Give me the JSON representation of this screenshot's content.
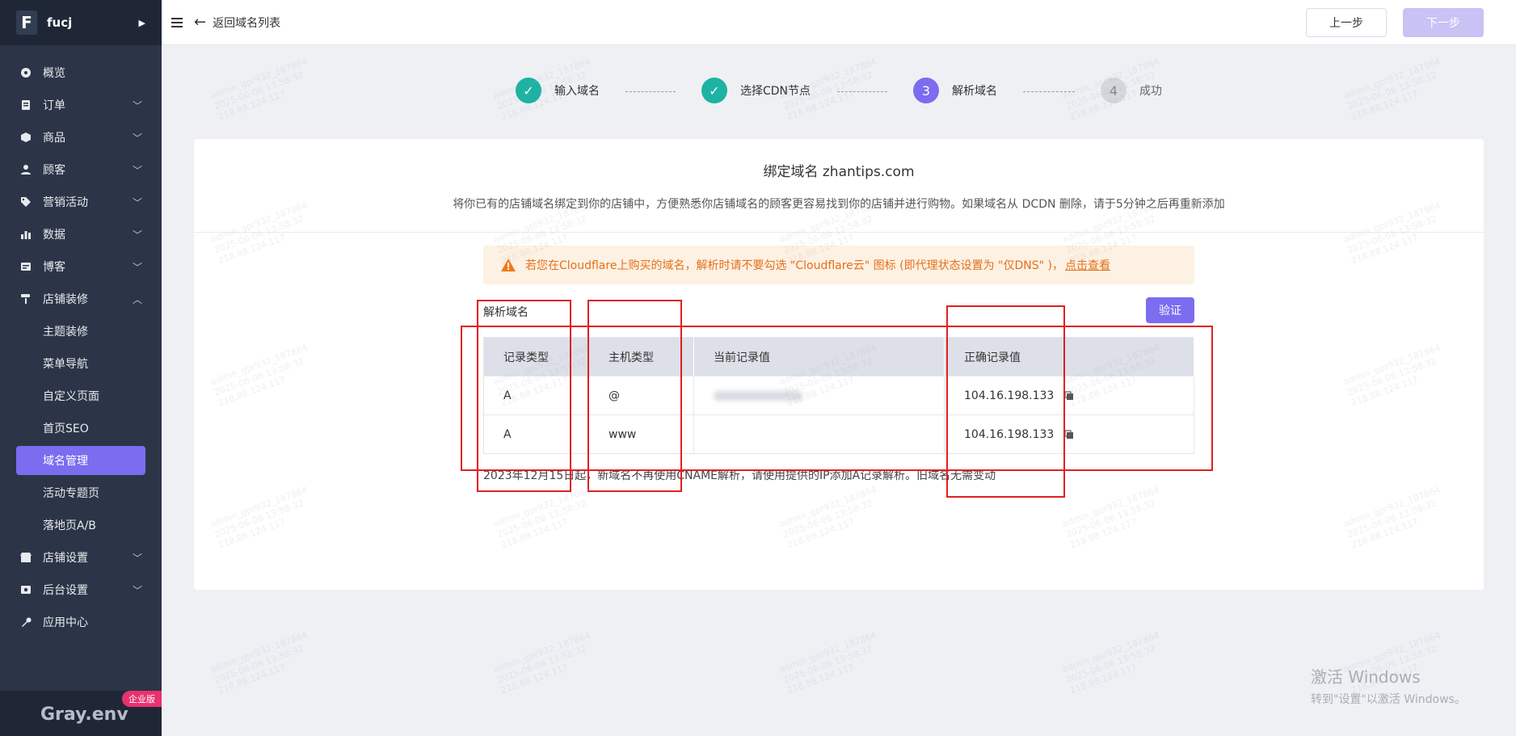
{
  "sidebar": {
    "brand_letter": "F",
    "brand_name": "fucj",
    "nav": [
      {
        "label": "概览",
        "icon": "dashboard-icon"
      },
      {
        "label": "订单",
        "icon": "order-icon"
      },
      {
        "label": "商品",
        "icon": "product-icon"
      },
      {
        "label": "顾客",
        "icon": "customer-icon"
      },
      {
        "label": "营销活动",
        "icon": "marketing-tag-icon"
      },
      {
        "label": "数据",
        "icon": "chart-icon"
      },
      {
        "label": "博客",
        "icon": "blog-icon"
      },
      {
        "label": "店铺装修",
        "icon": "paint-roller-icon"
      },
      {
        "label": "店铺设置",
        "icon": "store-settings-icon"
      },
      {
        "label": "后台设置",
        "icon": "admin-settings-icon"
      },
      {
        "label": "应用中心",
        "icon": "wrench-icon"
      }
    ],
    "sub_items": [
      "主题装修",
      "菜单导航",
      "自定义页面",
      "首页SEO",
      "域名管理",
      "活动专题页",
      "落地页A/B"
    ],
    "env_label": "Gray.env",
    "edition_badge": "企业版"
  },
  "topbar": {
    "back_label": "返回域名列表",
    "prev_button": "上一步",
    "next_button": "下一步"
  },
  "steps": [
    {
      "label": "输入域名",
      "state": "done",
      "number": "1"
    },
    {
      "label": "选择CDN节点",
      "state": "done",
      "number": "2"
    },
    {
      "label": "解析域名",
      "state": "current",
      "number": "3"
    },
    {
      "label": "成功",
      "state": "todo",
      "number": "4"
    }
  ],
  "card": {
    "title": "绑定域名 zhantips.com",
    "description": "将你已有的店铺域名绑定到你的店铺中，方便熟悉你店铺域名的顾客更容易找到你的店铺并进行购物。如果域名从 DCDN 删除，请于5分钟之后再重新添加",
    "alert_text": "若您在Cloudflare上购买的域名，解析时请不要勾选 \"Cloudflare云\" 图标 (即代理状态设置为 \"仅DNS\" )，",
    "alert_link": "点击查看",
    "section_label": "解析域名",
    "verify_button": "验证",
    "table": {
      "headers": [
        "记录类型",
        "主机类型",
        "当前记录值",
        "正确记录值"
      ],
      "rows": [
        {
          "type": "A",
          "host": "@",
          "current": "",
          "correct": "104.16.198.133"
        },
        {
          "type": "A",
          "host": "www",
          "current": "",
          "correct": "104.16.198.133"
        }
      ]
    },
    "note": "2023年12月15日起，新域名不再使用CNAME解析，请使用提供的IP添加A记录解析。旧域名无需变动"
  },
  "watermark": {
    "line1": "admin_gpr932_187864",
    "line2": "2025-06-06 13:58:32",
    "line3": "218.88.124.117"
  },
  "windows": {
    "line1": "激活 Windows",
    "line2": "转到\"设置\"以激活 Windows。"
  },
  "colors": {
    "sidebar_bg": "#2c3547",
    "accent": "#7b6cf0",
    "step_done": "#1cb3a3",
    "alert_text": "#e6701a",
    "annotation_red": "#e02020"
  }
}
